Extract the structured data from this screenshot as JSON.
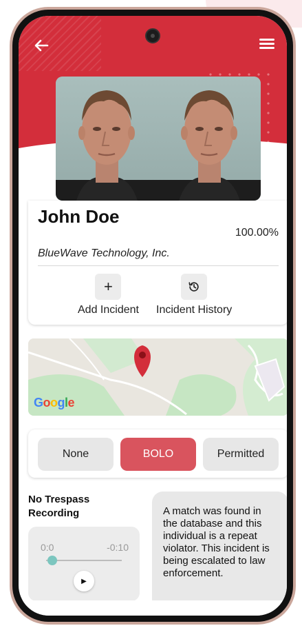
{
  "header": {
    "back_icon": "arrow-left-icon",
    "menu_icon": "hamburger-menu-icon",
    "accent_color": "#d32e3b"
  },
  "profile": {
    "name": "John Doe",
    "match_percent": "100.00%",
    "company": "BlueWave Technology, Inc."
  },
  "actions": {
    "add_incident": {
      "icon": "+",
      "label": "Add Incident"
    },
    "incident_history": {
      "icon": "history-icon",
      "label": "Incident History"
    }
  },
  "map": {
    "logo_letters": [
      "G",
      "o",
      "o",
      "g",
      "l",
      "e"
    ],
    "pin_icon": "map-pin-icon"
  },
  "status": {
    "options": [
      "None",
      "BOLO",
      "Permitted"
    ],
    "selected": "BOLO",
    "active_color": "#d9545e"
  },
  "recording": {
    "title": "No Trespass Recording",
    "time_start": "0:0",
    "time_end": "-0:10",
    "play_icon": "▶"
  },
  "alert": {
    "message": "A match was found in the database and this individual is a repeat violator. This incident is being escalated to law enforcement."
  }
}
